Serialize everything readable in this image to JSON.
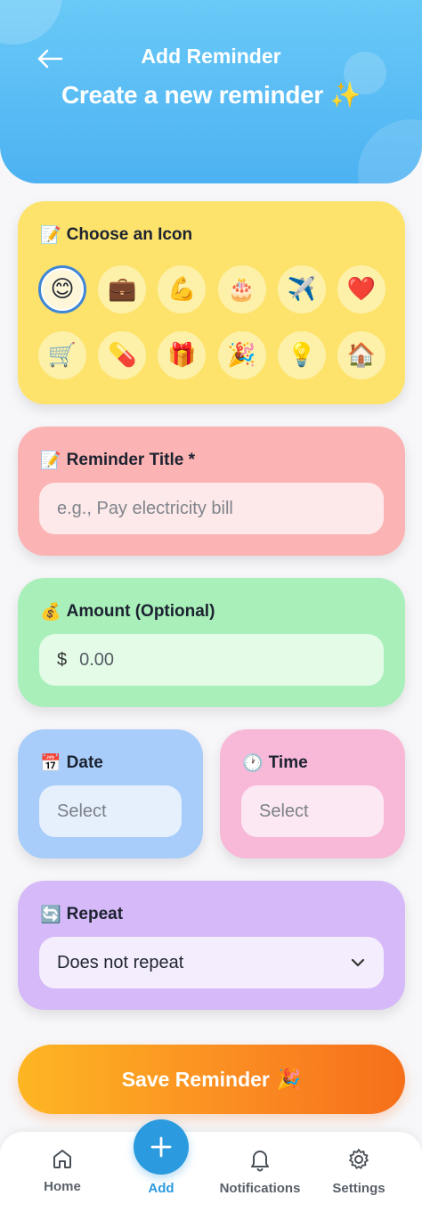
{
  "header": {
    "title": "Add Reminder",
    "subtitle": "Create a new reminder ✨",
    "back_icon": "arrow-left-icon"
  },
  "icon_picker": {
    "label": "Choose an Icon",
    "label_emoji": "📝",
    "selected": "😊",
    "icons": [
      "😊",
      "💼",
      "💪",
      "🎂",
      "✈️",
      "❤️",
      "🛒",
      "💊",
      "🎁",
      "🎉",
      "💡",
      "🏠"
    ]
  },
  "title_field": {
    "label": "Reminder Title *",
    "label_emoji": "📝",
    "placeholder": "e.g., Pay electricity bill"
  },
  "amount_field": {
    "label": "Amount (Optional)",
    "label_emoji": "💰",
    "currency": "$",
    "value": "0.00"
  },
  "date_field": {
    "label": "Date",
    "label_emoji": "📅",
    "placeholder": "Select"
  },
  "time_field": {
    "label": "Time",
    "label_emoji": "🕐",
    "placeholder": "Select"
  },
  "repeat_field": {
    "label": "Repeat",
    "label_emoji": "🔄",
    "value": "Does not repeat"
  },
  "save_button": {
    "label": "Save Reminder",
    "emoji": "🎉"
  },
  "nav": {
    "home": "Home",
    "add": "Add",
    "notifications": "Notifications",
    "settings": "Settings",
    "active": "add"
  },
  "colors": {
    "header": "#4db2f2",
    "icon_card": "#fde36c",
    "title_card": "#fbb3b3",
    "amount_card": "#a9efba",
    "date_card": "#a8cdfa",
    "time_card": "#f8b9d8",
    "repeat_card": "#d6b9f8",
    "accent": "#2b9adf",
    "save_gradient_start": "#fdb623",
    "save_gradient_end": "#f66f1a"
  }
}
